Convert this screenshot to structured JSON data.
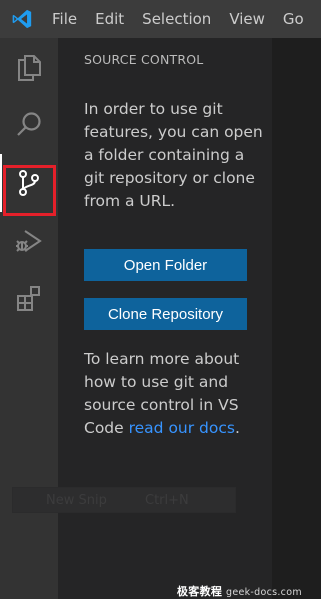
{
  "menubar": {
    "logo_icon": "vscode-logo-icon",
    "items": [
      "File",
      "Edit",
      "Selection",
      "View",
      "Go"
    ]
  },
  "activitybar": {
    "items": [
      {
        "name": "explorer",
        "icon": "files-icon"
      },
      {
        "name": "search",
        "icon": "search-icon"
      },
      {
        "name": "source-control",
        "icon": "source-control-icon",
        "active": true
      },
      {
        "name": "run-debug",
        "icon": "run-debug-icon"
      },
      {
        "name": "extensions",
        "icon": "extensions-icon"
      }
    ],
    "highlight_color": "#e5202a"
  },
  "sidebar": {
    "title": "SOURCE CONTROL",
    "message": "In order to use git features, you can open a folder containing a git repository or clone from a URL.",
    "open_folder_label": "Open Folder",
    "clone_repository_label": "Clone Repository",
    "learn_more_prefix": "To learn more about how to use git and source control in VS Code ",
    "docs_link_label": "read our docs",
    "learn_more_suffix": "."
  },
  "ghost_tooltip": {
    "left": "New Snip",
    "right": "Ctrl+N"
  },
  "watermark": {
    "brand": "极客教程",
    "url": "geek-docs.com"
  },
  "colors": {
    "button_bg": "#0e639c",
    "link": "#3794ff",
    "sidebar_bg": "#252526",
    "activitybar_bg": "#333333",
    "titlebar_bg": "#3c3c3c"
  }
}
